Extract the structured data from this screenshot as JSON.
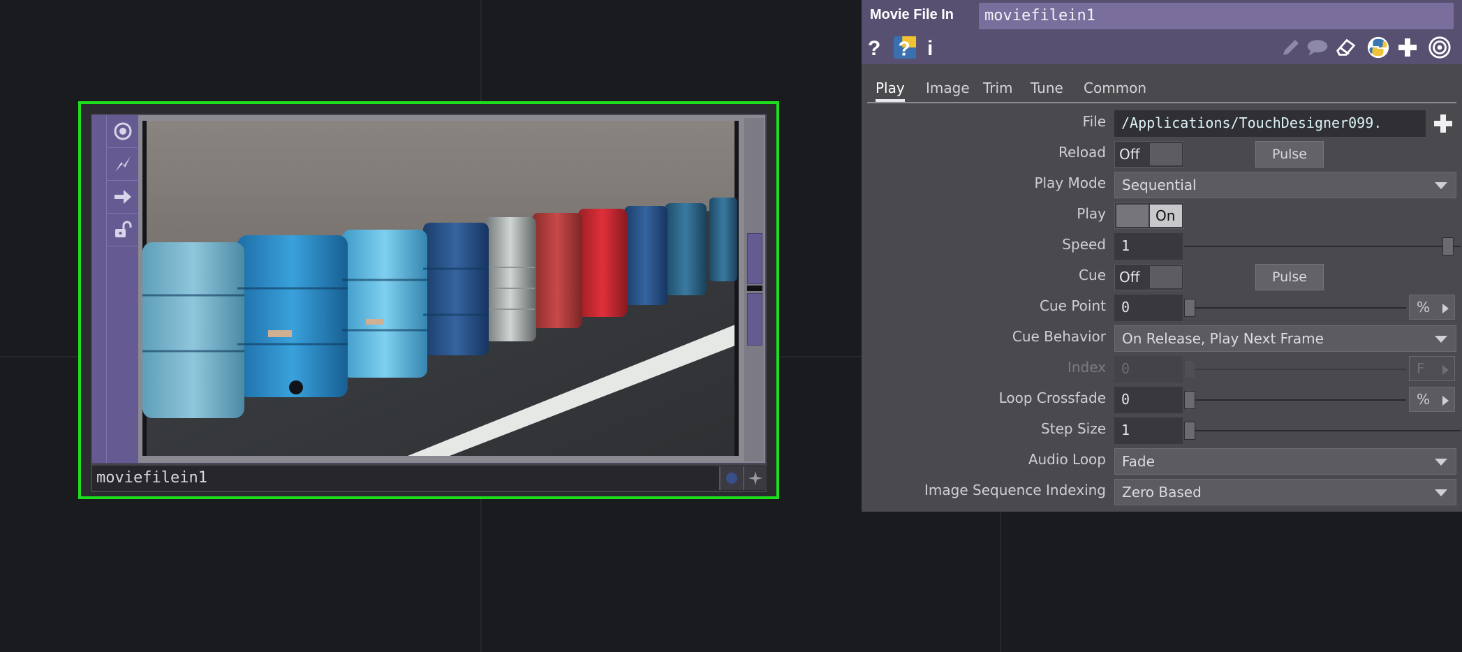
{
  "node": {
    "name": "moviefilein1",
    "side_icons": [
      "viewer-active-icon",
      "cook-icon",
      "export-icon",
      "lock-open-icon"
    ],
    "footer_icons": [
      "bypass-dot-icon",
      "display-flag-icon"
    ],
    "border_color": "#1de01d",
    "accent_color": "#665a92"
  },
  "panel": {
    "op_type": "Movie File In",
    "op_name": "moviefilein1",
    "header_left_icons": [
      "help-icon",
      "python-help-icon",
      "info-icon"
    ],
    "header_right_icons": [
      "edit-icon",
      "comment-icon",
      "eraser-icon",
      "python-icon",
      "add-icon",
      "target-icon"
    ],
    "tabs": [
      "Play",
      "Image",
      "Trim",
      "Tune",
      "Common"
    ],
    "active_tab": "Play",
    "params": {
      "file": {
        "label": "File",
        "value": "/Applications/TouchDesigner099."
      },
      "reload": {
        "label": "Reload",
        "toggle": "Off",
        "pulse": "Pulse"
      },
      "play_mode": {
        "label": "Play Mode",
        "value": "Sequential"
      },
      "play": {
        "label": "Play",
        "toggle": "On"
      },
      "speed": {
        "label": "Speed",
        "value": "1"
      },
      "cue": {
        "label": "Cue",
        "toggle": "Off",
        "pulse": "Pulse"
      },
      "cue_point": {
        "label": "Cue Point",
        "value": "0",
        "unit": "%"
      },
      "cue_behavior": {
        "label": "Cue Behavior",
        "value": "On Release, Play Next Frame"
      },
      "index": {
        "label": "Index",
        "value": "0",
        "unit": "F"
      },
      "loop_crossfade": {
        "label": "Loop Crossfade",
        "value": "0",
        "unit": "%"
      },
      "step_size": {
        "label": "Step Size",
        "value": "1"
      },
      "audio_loop": {
        "label": "Audio Loop",
        "value": "Fade"
      },
      "image_sequence_indexing": {
        "label": "Image Sequence Indexing",
        "value": "Zero Based"
      }
    }
  }
}
